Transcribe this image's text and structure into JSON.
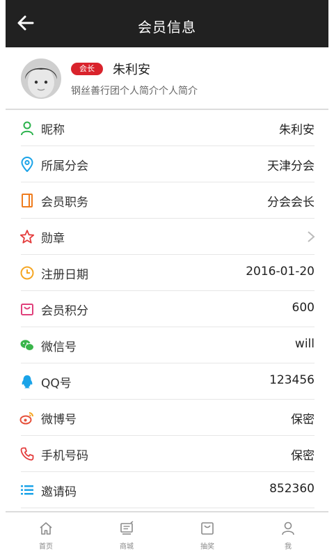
{
  "header": {
    "title": "会员信息"
  },
  "profile": {
    "badge": "会长",
    "name": "朱利安",
    "intro": "钢丝善行团个人简介个人简介"
  },
  "rows": [
    {
      "icon": "user-icon",
      "label": "昵称",
      "value": "朱利安",
      "color": "#2bb24c"
    },
    {
      "icon": "location-pin-icon",
      "label": "所属分会",
      "value": "天津分会",
      "color": "#1aa3e8"
    },
    {
      "icon": "notebook-icon",
      "label": "会员职务",
      "value": "分会会长",
      "color": "#ef7c1e"
    },
    {
      "icon": "star-icon",
      "label": "勋章",
      "value": "",
      "color": "#e43c3c"
    },
    {
      "icon": "clock-icon",
      "label": "注册日期",
      "value": "2016-01-20",
      "color": "#f5a623"
    },
    {
      "icon": "points-bag-icon",
      "label": "会员积分",
      "value": "600",
      "color": "#e0407b"
    },
    {
      "icon": "wechat-icon",
      "label": "微信号",
      "value": "will",
      "color": "#39b54a"
    },
    {
      "icon": "qq-icon",
      "label": "QQ号",
      "value": "123456",
      "color": "#1aa3e8"
    },
    {
      "icon": "weibo-icon",
      "label": "微博号",
      "value": "保密",
      "color": "#e6513b"
    },
    {
      "icon": "phone-icon",
      "label": "手机号码",
      "value": "保密",
      "color": "#e43c3c"
    },
    {
      "icon": "invite-code-icon",
      "label": "邀请码",
      "value": "852360",
      "color": "#1aa3e8"
    }
  ],
  "tabs": [
    {
      "icon": "home-icon",
      "label": "首页"
    },
    {
      "icon": "mall-icon",
      "label": "商城"
    },
    {
      "icon": "lottery-icon",
      "label": "抽奖"
    },
    {
      "icon": "me-icon",
      "label": "我"
    }
  ],
  "colors": {
    "topbar": "#212121",
    "badge": "#d9232c"
  }
}
